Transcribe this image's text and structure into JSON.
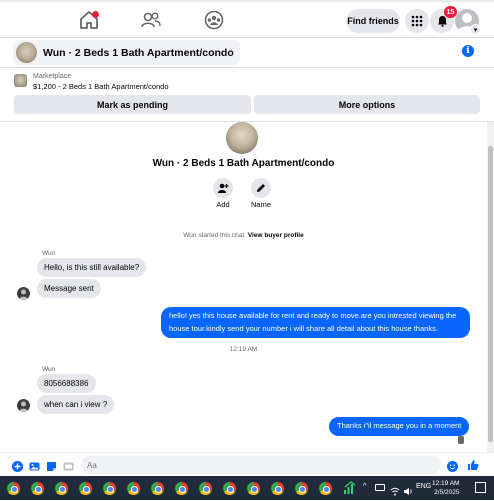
{
  "topnav": {
    "find_friends_label": "Find friends",
    "notification_count": "15"
  },
  "chat_header": {
    "title": "Wun · 2 Beds 1 Bath Apartment/condo"
  },
  "marketplace": {
    "label": "Marketplace",
    "listing": "$1,200 - 2 Beds 1 Bath Apartment/condo",
    "mark_pending_label": "Mark as pending",
    "more_options_label": "More options"
  },
  "intro": {
    "title": "Wun · 2 Beds 1 Bath Apartment/condo",
    "add_label": "Add",
    "name_label": "Name",
    "started_text": "Wun started this chat.",
    "view_profile_link": "View buyer profile"
  },
  "messages": [
    {
      "sender": "Wun",
      "text": "Hello, is this still available?",
      "direction": "in"
    },
    {
      "text": "Message sent",
      "direction": "in"
    },
    {
      "text": "hello! yes this house available for rent and ready to move.are you intrested viewing the house tour.kindly send your number i will share all detail about this house thanks.",
      "direction": "out"
    },
    {
      "timestamp": "12:19 AM"
    },
    {
      "sender": "Wun",
      "text": "8056688386",
      "direction": "in"
    },
    {
      "text": "when can i view ?",
      "direction": "in"
    },
    {
      "text": "Thanks i\"il message you in a moment",
      "direction": "out"
    }
  ],
  "composer": {
    "placeholder": "Aa"
  },
  "taskbar": {
    "language": "ENG",
    "time": "12:19 AM",
    "date": "2/5/2025"
  },
  "colors": {
    "accent": "#0866ff",
    "incoming_bubble": "#e4e6eb",
    "badge": "#e41e3f",
    "taskbar": "#1f2b3a"
  },
  "icons": {
    "nav": [
      "home-icon",
      "friends-icon",
      "groups-icon"
    ],
    "header_right": [
      "menu-grid-icon",
      "bell-icon",
      "profile-avatar"
    ],
    "composer": [
      "plus-icon",
      "photo-icon",
      "sticker-icon",
      "gif-icon",
      "emoji-icon",
      "like-icon"
    ]
  }
}
